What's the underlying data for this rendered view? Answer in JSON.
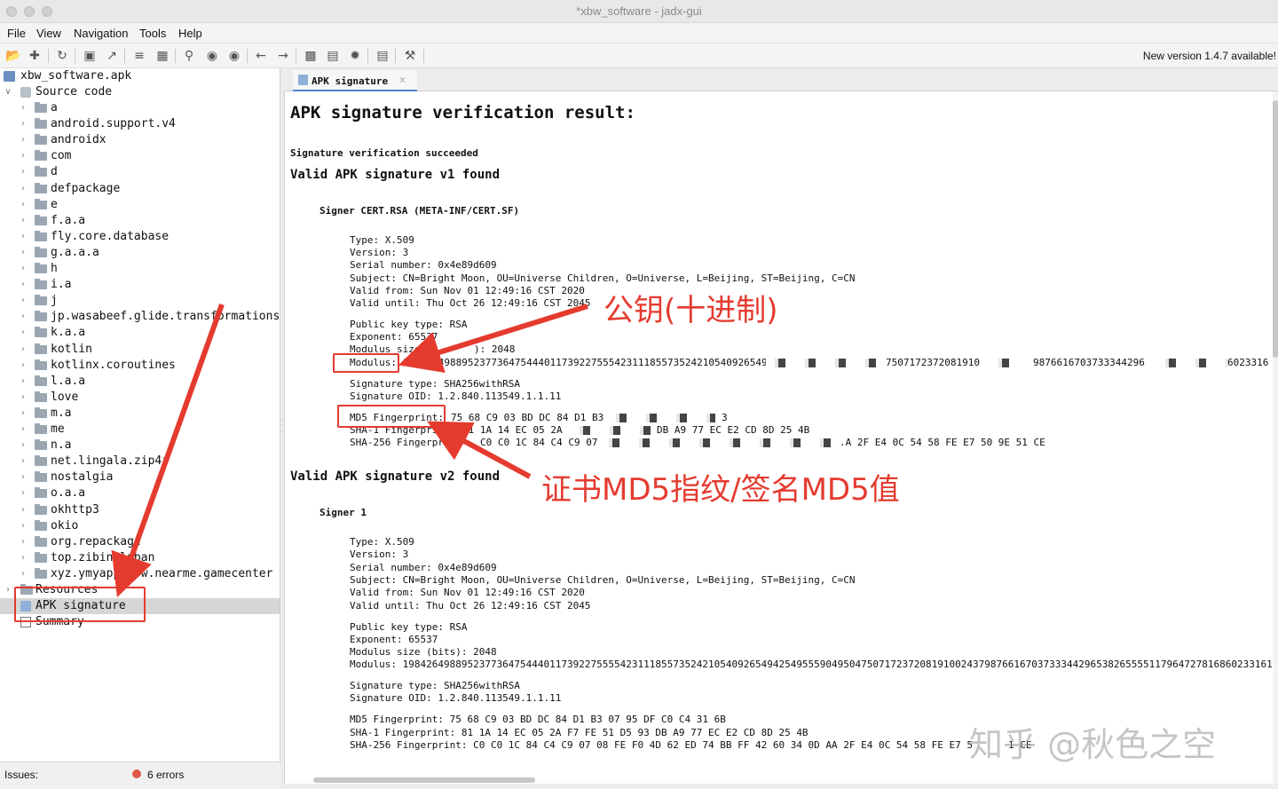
{
  "window": {
    "title": "*xbw_software - jadx-gui"
  },
  "menu": [
    "File",
    "View",
    "Navigation",
    "Tools",
    "Help"
  ],
  "toolbar": {
    "new_version": "New version 1.4.7 available!",
    "icons": [
      "open-file-icon",
      "add-files-icon",
      "sync-icon",
      "save-icon",
      "export-icon",
      "flatten-icon",
      "package-icon",
      "search-icon",
      "find-usage-icon",
      "find-class-icon",
      "back-icon",
      "forward-icon",
      "deobfuscation-icon",
      "bookmark-icon",
      "debug-icon",
      "log-icon",
      "preferences-icon"
    ]
  },
  "tree": {
    "root": "xbw_software.apk",
    "source_code": "Source code",
    "packages": [
      "a",
      "android.support.v4",
      "androidx",
      "com",
      "d",
      "defpackage",
      "e",
      "f.a.a",
      "fly.core.database",
      "g.a.a.a",
      "h",
      "i.a",
      "j",
      "jp.wasabeef.glide.transformations",
      "k.a.a",
      "kotlin",
      "kotlinx.coroutines",
      "l.a.a",
      "love",
      "m.a",
      "me",
      "n.a",
      "net.lingala.zip4j",
      "nostalgia",
      "o.a.a",
      "okhttp3",
      "okio",
      "org.repackage",
      "top.zibin.luban",
      "xyz.ymyapp.xbw.nearme.gamecenter"
    ],
    "resources": "Resources",
    "apk_signature": "APK signature",
    "summary": "Summary"
  },
  "status": {
    "issues_label": "Issues:",
    "errors": "6 errors"
  },
  "tab": {
    "label": "APK signature",
    "close": "×"
  },
  "content": {
    "heading": "APK signature verification result:",
    "succeeded": "Signature verification succeeded",
    "v1": {
      "title": "Valid APK signature v1 found",
      "signer": "Signer CERT.RSA (META-INF/CERT.SF)",
      "type": "Type: X.509",
      "version": "Version: 3",
      "serial": "Serial number: 0x4e89d609",
      "subject": "Subject: CN=Bright Moon, OU=Universe Children, O=Universe, L=Beijing, ST=Beijing, C=CN",
      "valid_from": "Valid from: Sun Nov 01 12:49:16 CST 2020",
      "valid_until": "Valid until: Thu Oct 26 12:49:16 CST 2045",
      "pk_type": "Public key type: RSA",
      "exponent": "Exponent: 65537",
      "modulus_size_left": "Modulus size",
      "modulus_size_right": "): 2048",
      "modulus_label": "Modulus:",
      "modulus_a": "19842649889523773647544401173922755542311185573524210540926549",
      "modulus_b": "7507172372081910",
      "modulus_c": "9876616703733344296",
      "modulus_d": "6023316",
      "sig_type": "Signature type: SHA256withRSA",
      "sig_oid": "Signature OID: 1.2.840.113549.1.1.11",
      "md5_label": "MD5 Fingerprint:",
      "md5_value": "75 68 C9 03 BD DC 84 D1 B3",
      "md5_tail": "3",
      "sha1_label": "SHA-1 Fingerpri",
      "sha1_a": "81 1A 14 EC 05 2A",
      "sha1_b": "DB A9 77 EC E2 CD 8D 25 4B",
      "sha256_label": "SHA-256 Fingerprin",
      "sha256_a": "C0 C0 1C 84 C4 C9 07",
      "sha256_b": ".A 2F E4 0C 54 58 FE E7 50 9E 51 CE"
    },
    "v2": {
      "title": "Valid APK signature v2 found",
      "signer": "Signer 1",
      "type": "Type: X.509",
      "version": "Version: 3",
      "serial": "Serial number: 0x4e89d609",
      "subject": "Subject: CN=Bright Moon, OU=Universe Children, O=Universe, L=Beijing, ST=Beijing, C=CN",
      "valid_from": "Valid from: Sun Nov 01 12:49:16 CST 2020",
      "valid_until": "Valid until: Thu Oct 26 12:49:16 CST 2045",
      "pk_type": "Public key type: RSA",
      "exponent": "Exponent: 65537",
      "modulus_size": "Modulus size (bits): 2048",
      "modulus": "Modulus: 1984264988952377364754440117392275555423111855735242105409265494254955590495047507172372081910024379876616703733344296538265555117964727816860233161",
      "sig_type": "Signature type: SHA256withRSA",
      "sig_oid": "Signature OID: 1.2.840.113549.1.1.11",
      "md5": "MD5 Fingerprint: 75 68 C9 03 BD DC 84 D1 B3 07 95 DF C0 C4 31 6B",
      "sha1": "SHA-1 Fingerprint: 81 1A 14 EC 05 2A F7 FE 51 D5 93 DB A9 77 EC E2 CD 8D 25 4B",
      "sha256": "SHA-256 Fingerprint: C0 C0 1C 84 C4 C9 07 08 FE F0 4D 62 ED 74 BB FF 42 60 34 0D AA 2F E4 0C 54 58 FE E7 5",
      "sha256_tail": "1 CE"
    }
  },
  "annotations": {
    "pubkey": "公钥(十进制)",
    "md5": "证书MD5指纹/签名MD5值",
    "color": "#e53b2f"
  },
  "watermark": "知乎 @秋色之空"
}
